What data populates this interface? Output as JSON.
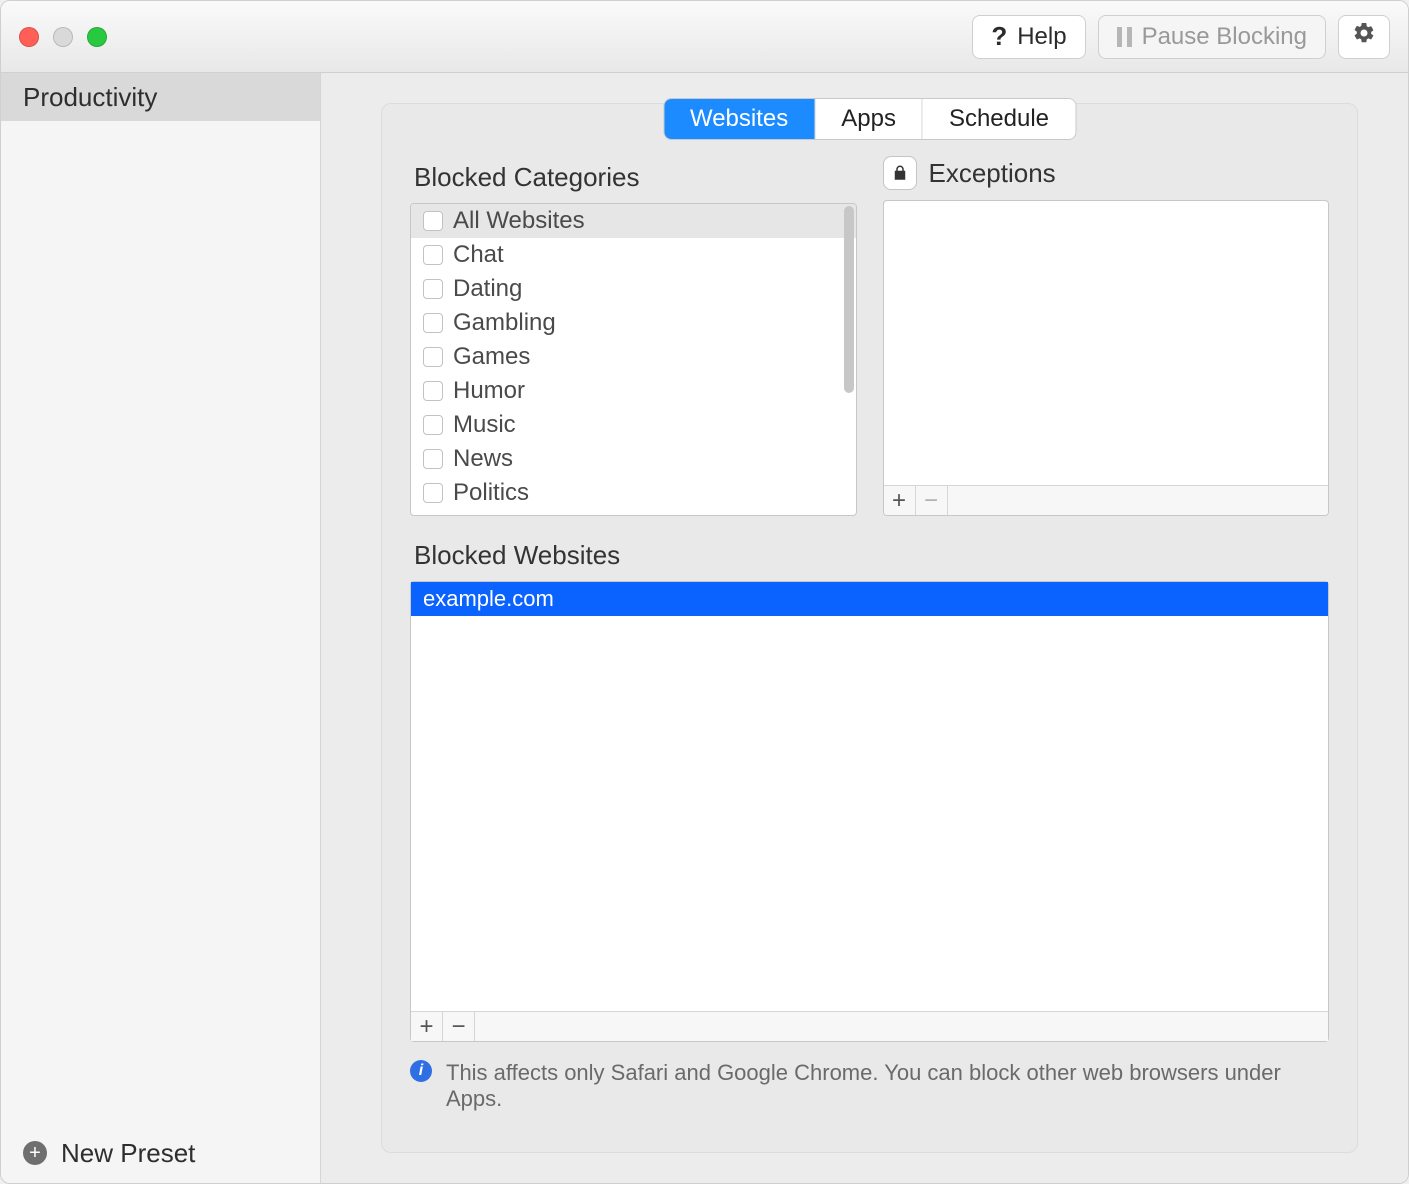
{
  "toolbar": {
    "help_label": "Help",
    "pause_label": "Pause Blocking"
  },
  "sidebar": {
    "items": [
      {
        "label": "Productivity"
      }
    ],
    "new_preset_label": "New Preset"
  },
  "tabs": {
    "websites": "Websites",
    "apps": "Apps",
    "schedule": "Schedule",
    "active": "Websites"
  },
  "sections": {
    "blocked_categories": "Blocked Categories",
    "exceptions": "Exceptions",
    "blocked_websites": "Blocked Websites"
  },
  "categories": [
    {
      "label": "All Websites",
      "checked": false,
      "selected": true
    },
    {
      "label": "Chat",
      "checked": false,
      "selected": false
    },
    {
      "label": "Dating",
      "checked": false,
      "selected": false
    },
    {
      "label": "Gambling",
      "checked": false,
      "selected": false
    },
    {
      "label": "Games",
      "checked": false,
      "selected": false
    },
    {
      "label": "Humor",
      "checked": false,
      "selected": false
    },
    {
      "label": "Music",
      "checked": false,
      "selected": false
    },
    {
      "label": "News",
      "checked": false,
      "selected": false
    },
    {
      "label": "Politics",
      "checked": false,
      "selected": false
    }
  ],
  "exceptions": [],
  "blocked_websites": [
    {
      "label": "example.com",
      "selected": true
    }
  ],
  "note": "This affects only Safari and Google Chrome. You can block other web browsers under Apps.",
  "icons": {
    "plus": "+",
    "minus": "−"
  }
}
